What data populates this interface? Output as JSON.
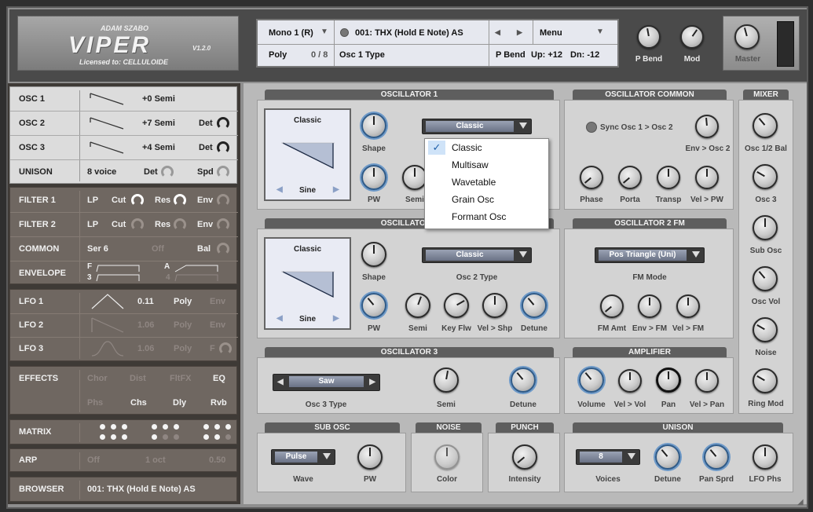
{
  "brand": {
    "author": "ADAM SZABO",
    "product": "VIPER",
    "version": "V1.2.0",
    "license": "Licensed to: CELLULOIDE"
  },
  "lcd": {
    "voice_mode": "Mono 1 (R)",
    "patch": "001: THX (Hold E Note) AS",
    "menu": "Menu",
    "poly": "Poly",
    "voices": "0 / 8",
    "param": "Osc 1 Type",
    "pbend_label": "P Bend",
    "up": "Up: +12",
    "dn": "Dn: -12"
  },
  "top_knobs": {
    "pbend": "P Bend",
    "mod": "Mod",
    "master": "Master"
  },
  "osc_rows": [
    {
      "name": "OSC 1",
      "semi": "+0 Semi",
      "det": ""
    },
    {
      "name": "OSC 2",
      "semi": "+7 Semi",
      "det": "Det"
    },
    {
      "name": "OSC 3",
      "semi": "+4 Semi",
      "det": "Det"
    }
  ],
  "unison_row": {
    "name": "UNISON",
    "voices": "8 voice",
    "det": "Det",
    "spd": "Spd"
  },
  "filter_rows": [
    {
      "name": "FILTER 1",
      "type": "LP",
      "cut": "Cut",
      "res": "Res",
      "env": "Env"
    },
    {
      "name": "FILTER 2",
      "type": "LP",
      "cut": "Cut",
      "res": "Res",
      "env": "Env"
    }
  ],
  "common_row": {
    "name": "COMMON",
    "mode": "Ser 6",
    "off": "Off",
    "bal": "Bal"
  },
  "envelope_row": {
    "name": "ENVELOPE",
    "f": "F",
    "a": "A",
    "n3": "3",
    "n4": "4"
  },
  "lfo_rows": [
    {
      "name": "LFO 1",
      "val": "0.11",
      "poly": "Poly",
      "env": "Env"
    },
    {
      "name": "LFO 2",
      "val": "1.06",
      "poly": "Poly",
      "env": "Env"
    },
    {
      "name": "LFO 3",
      "val": "1.06",
      "poly": "Poly",
      "env": "F"
    }
  ],
  "effects": {
    "name": "EFFECTS",
    "row1": [
      "Chor",
      "Dist",
      "FltFX",
      "EQ"
    ],
    "row2": [
      "Phs",
      "Chs",
      "Dly",
      "Rvb"
    ]
  },
  "matrix": {
    "name": "MATRIX"
  },
  "arp": {
    "name": "ARP",
    "off": "Off",
    "oct": "1 oct",
    "rate": "0.50"
  },
  "browser": {
    "name": "BROWSER",
    "patch": "001: THX (Hold E Note) AS"
  },
  "osc1": {
    "title": "OSCILLATOR 1",
    "wave_top": "Classic",
    "wave_bottom": "Sine",
    "combo": "Classic",
    "shape": "Shape",
    "pw": "PW",
    "semi": "Semi"
  },
  "dropdown": {
    "items": [
      "Classic",
      "Multisaw",
      "Wavetable",
      "Grain Osc",
      "Formant Osc"
    ],
    "selected": "Classic"
  },
  "osc_common": {
    "title": "OSCILLATOR COMMON",
    "sync": "Sync Osc 1 > Osc 2",
    "env_osc2": "Env > Osc 2",
    "phase": "Phase",
    "porta": "Porta",
    "transp": "Transp",
    "vel_pw": "Vel > PW"
  },
  "osc2": {
    "title": "OSCILLATOR 2",
    "wave_top": "Classic",
    "wave_bottom": "Sine",
    "combo": "Classic",
    "type_label": "Osc 2 Type",
    "shape": "Shape",
    "pw": "PW",
    "semi": "Semi",
    "keyflw": "Key Flw",
    "velshp": "Vel > Shp",
    "detune": "Detune"
  },
  "osc2fm": {
    "title": "OSCILLATOR 2 FM",
    "combo": "Pos Triangle (Uni)",
    "mode": "FM Mode",
    "amt": "FM Amt",
    "envfm": "Env > FM",
    "velfm": "Vel > FM"
  },
  "osc3": {
    "title": "OSCILLATOR 3",
    "type": "Saw",
    "type_label": "Osc 3 Type",
    "semi": "Semi",
    "detune": "Detune"
  },
  "amp": {
    "title": "AMPLIFIER",
    "volume": "Volume",
    "velvol": "Vel > Vol",
    "pan": "Pan",
    "velpan": "Vel > Pan"
  },
  "mixer": {
    "title": "MIXER",
    "items": [
      "Osc 1/2 Bal",
      "Osc 3",
      "Sub Osc",
      "Osc Vol",
      "Noise",
      "Ring Mod"
    ]
  },
  "subosc": {
    "title": "SUB OSC",
    "wave": "Pulse",
    "wave_label": "Wave",
    "pw": "PW"
  },
  "noise": {
    "title": "NOISE",
    "color": "Color"
  },
  "punch": {
    "title": "PUNCH",
    "intensity": "Intensity"
  },
  "unison": {
    "title": "UNISON",
    "voices": "8",
    "voices_label": "Voices",
    "detune": "Detune",
    "pansprd": "Pan Sprd",
    "lfophs": "LFO Phs"
  }
}
